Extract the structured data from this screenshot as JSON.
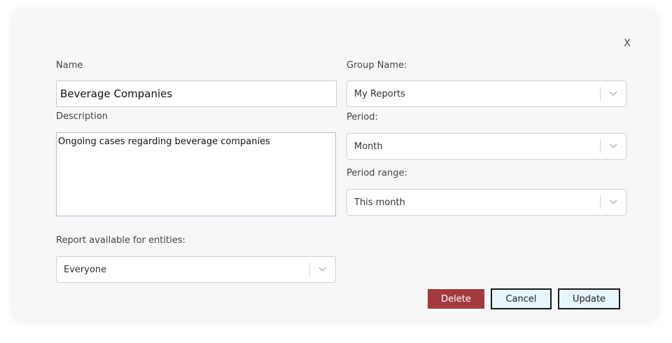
{
  "dialog": {
    "close_label": "X",
    "name": {
      "label": "Name",
      "value": "Beverage Companies"
    },
    "description": {
      "label": "Description",
      "value": "Ongoing cases regarding beverage companies"
    },
    "group_name": {
      "label": "Group Name:",
      "value": "My Reports"
    },
    "period": {
      "label": "Period:",
      "value": "Month"
    },
    "period_range": {
      "label": "Period range:",
      "value": "This month"
    },
    "entities": {
      "label": "Report available for entities:",
      "value": "Everyone"
    },
    "buttons": {
      "delete": "Delete",
      "cancel": "Cancel",
      "update": "Update"
    },
    "colors": {
      "delete_bg": "#a33a3d",
      "outline_bg": "#e6f6fb",
      "dialog_bg": "#f6f7f9"
    },
    "icons": {
      "close": "close-icon",
      "dropdown": "chevron-down-icon"
    }
  }
}
